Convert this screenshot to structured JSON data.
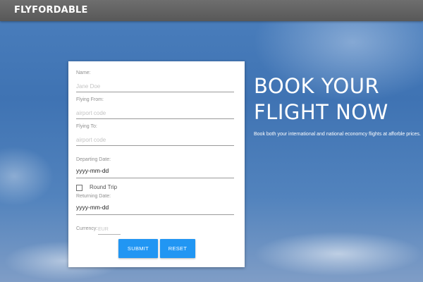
{
  "header": {
    "brand": "FLYFORDABLE"
  },
  "form": {
    "name": {
      "label": "Name:",
      "placeholder": "Jane Doe",
      "value": ""
    },
    "flying_from": {
      "label": "Flying From:",
      "placeholder": "airport code",
      "value": ""
    },
    "flying_to": {
      "label": "Flying To:",
      "placeholder": "airport code",
      "value": ""
    },
    "departing_date": {
      "label": "Departing Date:",
      "value": "yyyy-mm-dd"
    },
    "round_trip": {
      "label": "Round Trip",
      "checked": false
    },
    "returning_date": {
      "label": "Returning Date:",
      "value": "yyyy-mm-dd"
    },
    "currency": {
      "label": "Currency:",
      "placeholder": "EUR",
      "value": ""
    },
    "submit_label": "SUBMIT",
    "reset_label": "RESET"
  },
  "hero": {
    "title_line1": "BOOK YOUR",
    "title_line2": "FLIGHT NOW",
    "subtitle": "Book both your international and national economcy flights at afforble prices."
  },
  "colors": {
    "button": "#2196f3",
    "topbar": "#5f5f5f"
  }
}
